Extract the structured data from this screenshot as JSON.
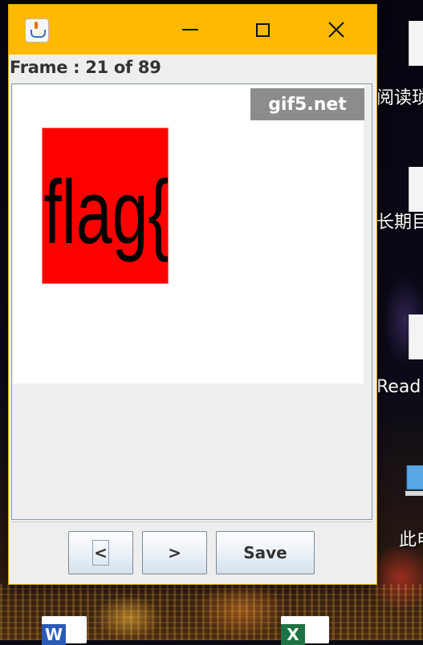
{
  "window": {
    "title": "",
    "frame_label": "Frame : 21 of 89",
    "accent_color": "#ffb900"
  },
  "viewer": {
    "watermark": "gif5.net",
    "frame_content": {
      "text": "flag{",
      "background": "#ff0000",
      "text_color": "#000000"
    }
  },
  "buttons": {
    "prev_label": "<",
    "next_label": ">",
    "save_label": "Save"
  },
  "desktop": {
    "icons": [
      {
        "label": "阅读琐"
      },
      {
        "label": "长期目"
      },
      {
        "label": "Read"
      },
      {
        "label": "此电"
      }
    ]
  },
  "taskbar": {
    "word_badge": "W",
    "excel_badge": "X"
  }
}
